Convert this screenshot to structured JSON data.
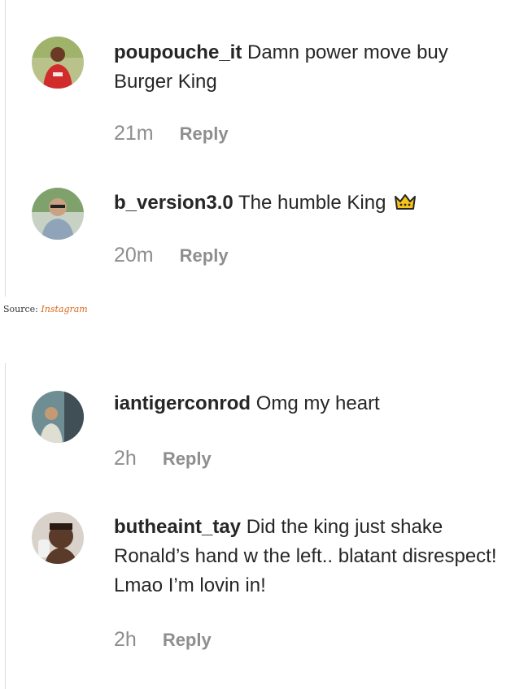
{
  "panel_top": {
    "comments": [
      {
        "username": "poupouche_it",
        "text": "Damn power move buy Burger King",
        "time": "21m",
        "reply": "Reply"
      },
      {
        "username": "b_version3.0",
        "text": "The humble King",
        "emoji": "crown-emoji",
        "time": "20m",
        "reply": "Reply"
      }
    ]
  },
  "source": {
    "label": "Source:",
    "link": "Instagram",
    "link_color": "#d9681c"
  },
  "panel_bottom": {
    "comments": [
      {
        "username": "iantigerconrod",
        "text": "Omg my heart",
        "time": "2h",
        "reply": "Reply"
      },
      {
        "username": "butheaint_tay",
        "text": "Did the king just shake Ronald’s hand w the left.. blatant disrespect! Lmao I’m lovin in!",
        "time": "2h",
        "reply": "Reply"
      }
    ]
  },
  "colors": {
    "text": "#262626",
    "muted": "#8e8e8e",
    "divider": "#dbdbdb"
  }
}
